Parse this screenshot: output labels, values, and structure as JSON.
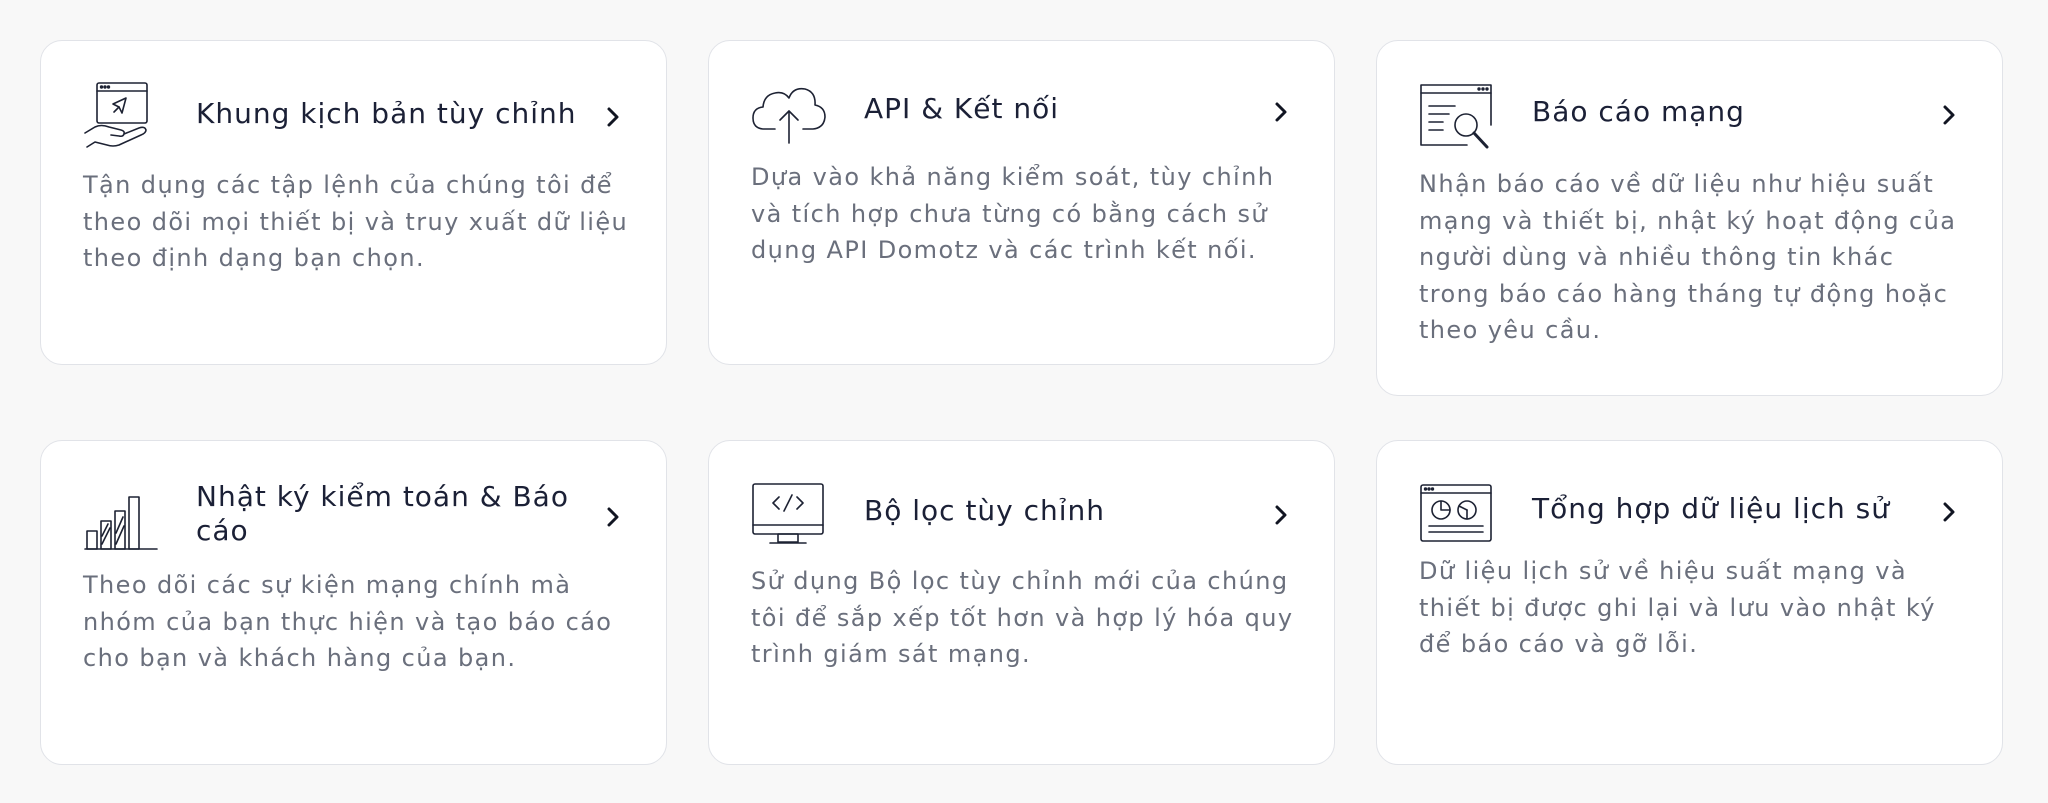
{
  "features": [
    {
      "icon": "hand-window-rocket-icon",
      "title": "Khung kịch bản tùy chỉnh",
      "description": "Tận dụng các tập lệnh của chúng tôi để\ntheo dõi mọi thiết bị và truy xuất dữ liệu\ntheo định dạng bạn chọn."
    },
    {
      "icon": "cloud-upload-icon",
      "title": "API & Kết nối",
      "description": "Dựa vào khả năng kiểm soát, tùy chỉnh\nvà tích hợp chưa từng có bằng cách sử\ndụng API Domotz và các trình kết nối."
    },
    {
      "icon": "report-magnifier-icon",
      "title": "Báo cáo mạng",
      "description": "Nhận báo cáo về dữ liệu như hiệu suất\nmạng và thiết bị, nhật ký hoạt động của\nngười dùng và nhiều thông tin khác\ntrong báo cáo hàng tháng tự động hoặc\ntheo yêu cầu."
    },
    {
      "icon": "bar-chart-icon",
      "title": "Nhật ký kiểm toán & Báo\ncáo",
      "description": "Theo dõi các sự kiện mạng chính mà\nnhóm của bạn thực hiện và tạo báo cáo\ncho bạn và khách hàng của bạn."
    },
    {
      "icon": "monitor-code-icon",
      "title": "Bộ lọc tùy chỉnh",
      "description": "Sử dụng Bộ lọc tùy chỉnh mới của chúng\ntôi để sắp xếp tốt hơn và hợp lý hóa quy\ntrình giám sát mạng."
    },
    {
      "icon": "browser-pie-chart-icon",
      "title": "Tổng hợp dữ liệu lịch sử",
      "description": "Dữ liệu lịch sử về hiệu suất mạng và\nthiết bị được ghi lại và lưu vào nhật ký\nđể báo cáo và gỡ lỗi."
    }
  ],
  "chevron_icon": "chevron-right-icon"
}
